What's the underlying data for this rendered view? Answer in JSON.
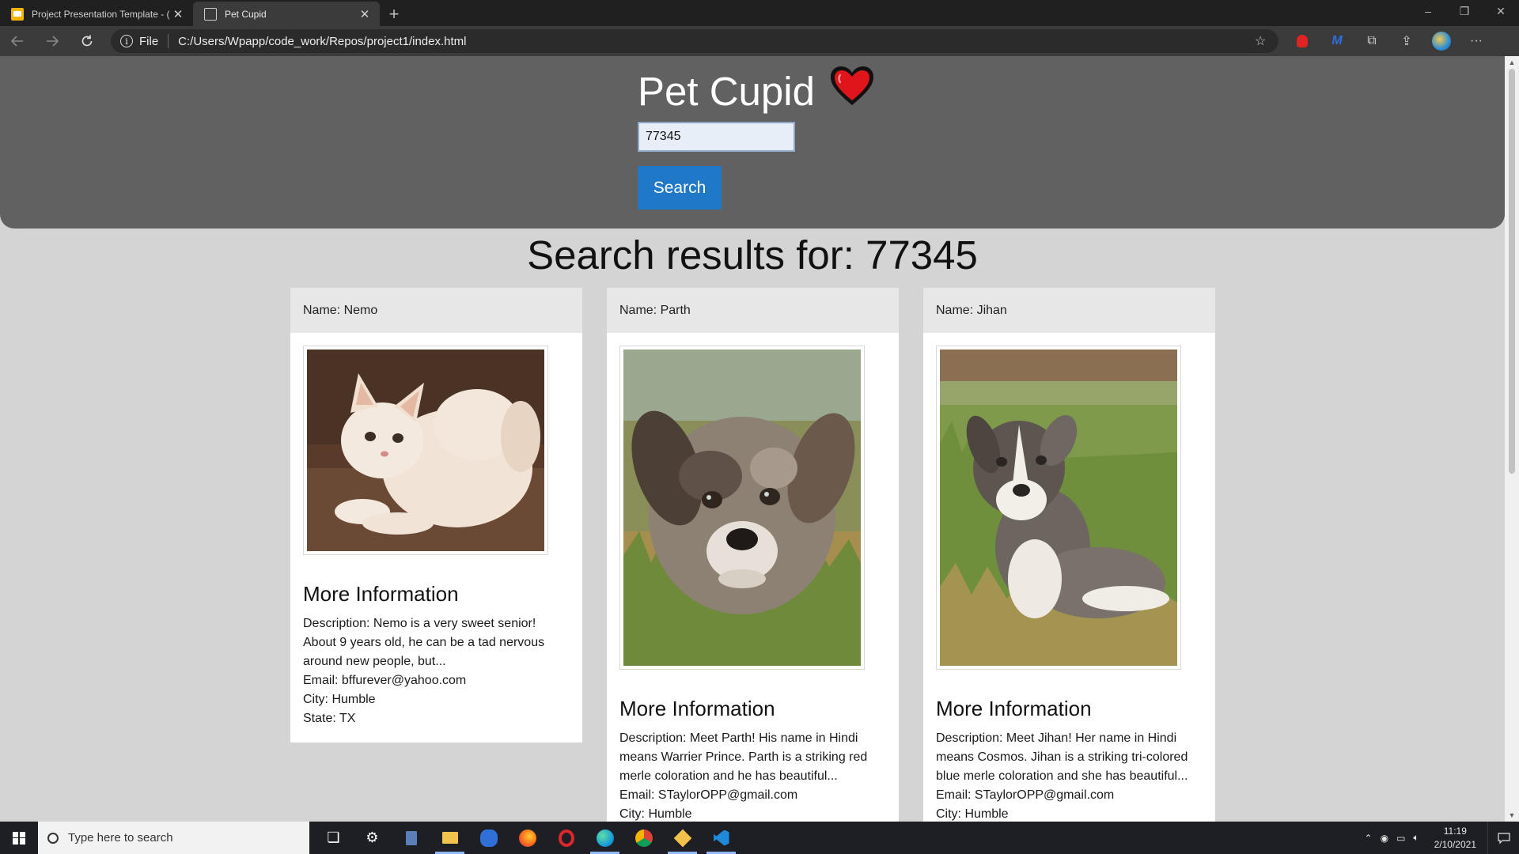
{
  "browser": {
    "tabs": [
      {
        "title": "Project Presentation Template - (",
        "active": false
      },
      {
        "title": "Pet Cupid",
        "active": true
      }
    ],
    "new_tab_label": "+",
    "address": {
      "scheme_label": "File",
      "url": "C:/Users/Wpapp/code_work/Repos/project1/index.html"
    },
    "window_controls": [
      "–",
      "❐",
      "✕"
    ],
    "toolbar_icons": [
      "favorites-icon",
      "ext-stop-icon",
      "ext-m-icon",
      "collections-icon",
      "share-icon",
      "profile-avatar-icon",
      "more-icon"
    ]
  },
  "page": {
    "title": "Pet Cupid",
    "heart_icon": "heart-icon",
    "search": {
      "value": "77345"
    },
    "search_button": "Search",
    "results_heading": "Search results for: 77345",
    "section_label": "More Information",
    "cards": [
      {
        "name": "Name: Nemo",
        "description": "Description: Nemo is a very sweet senior! About 9 years old, he can be a tad nervous around new people, but...",
        "email": "Email: bffurever@yahoo.com",
        "city": "City: Humble",
        "state": "State: TX",
        "photo": "white-cat-photo"
      },
      {
        "name": "Name: Parth",
        "description": "Description: Meet Parth! His name in Hindi means Warrier Prince. Parth is a striking red merle coloration and he has beautiful...",
        "email": "Email: STaylorOPP@gmail.com",
        "city": "City: Humble",
        "photo": "merle-puppy-photo"
      },
      {
        "name": "Name: Jihan",
        "description": "Description: Meet Jihan! Her name in Hindi means Cosmos. Jihan is a striking tri-colored blue merle coloration and she has beautiful...",
        "email": "Email: STaylorOPP@gmail.com",
        "city": "City: Humble",
        "photo": "tricolor-puppy-photo"
      }
    ]
  },
  "taskbar": {
    "search_placeholder": "Type here to search",
    "apps": [
      "task-view-icon",
      "settings-icon",
      "calculator-icon",
      "file-explorer-icon",
      "onedrive-icon",
      "firefox-icon",
      "opera-icon",
      "edge-icon",
      "chrome-icon",
      "git-icon",
      "vscode-icon"
    ],
    "clock_time": "11:19",
    "clock_date": "2/10/2021"
  },
  "colors": {
    "hero_bg": "#616161",
    "page_bg": "#d4d4d4",
    "button_blue": "#1f78c8",
    "heart_red": "#e0151b"
  }
}
